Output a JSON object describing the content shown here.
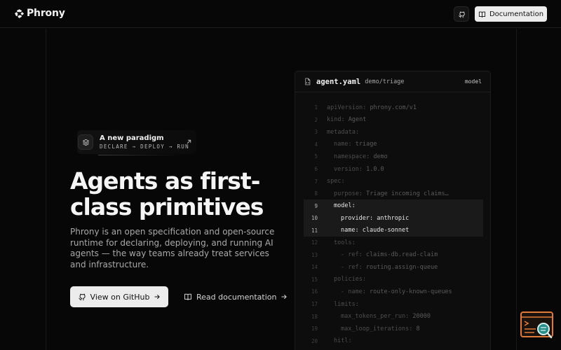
{
  "brand": {
    "name": "Phrony"
  },
  "header": {
    "documentation_label": "Documentation"
  },
  "hero": {
    "badge_title": "A new paradigm",
    "badge_subtitle": "DECLARE → DEPLOY → RUN",
    "headline": "Agents as first-class primitives",
    "lede": "Phrony is an open specification and open-source runtime for declaring, deploying, and running AI agents — the way teams already treat services and infrastructure.",
    "primary_cta": "View on GitHub",
    "secondary_cta": "Read documentation"
  },
  "editor": {
    "file_name": "agent.yaml",
    "file_path": "demo/triage",
    "file_tag": "model",
    "highlighted_lines": [
      9,
      10,
      11
    ],
    "lines": [
      {
        "n": "1",
        "key": "apiVersion",
        "value": "phrony.com/v1",
        "indent": 0
      },
      {
        "n": "2",
        "key": "kind",
        "value": "Agent",
        "indent": 0
      },
      {
        "n": "3",
        "key": "metadata",
        "value": "",
        "indent": 0
      },
      {
        "n": "4",
        "key": "name",
        "value": "triage",
        "indent": 1
      },
      {
        "n": "5",
        "key": "namespace",
        "value": "demo",
        "indent": 1
      },
      {
        "n": "6",
        "key": "version",
        "value": "1.0.0",
        "indent": 1
      },
      {
        "n": "7",
        "key": "spec",
        "value": "",
        "indent": 0
      },
      {
        "n": "8",
        "key": "purpose",
        "value": "Triage incoming claims…",
        "indent": 1
      },
      {
        "n": "9",
        "key": "model",
        "value": "",
        "indent": 1
      },
      {
        "n": "10",
        "key": "provider",
        "value": "anthropic",
        "indent": 2
      },
      {
        "n": "11",
        "key": "name",
        "value": "claude-sonnet",
        "indent": 2
      },
      {
        "n": "12",
        "key": "tools",
        "value": "",
        "indent": 1
      },
      {
        "n": "13",
        "key": "- ref",
        "value": "claims-db.read-claim",
        "indent": 2
      },
      {
        "n": "14",
        "key": "- ref",
        "value": "routing.assign-queue",
        "indent": 2
      },
      {
        "n": "15",
        "key": "policies",
        "value": "",
        "indent": 1
      },
      {
        "n": "16",
        "key": "- name",
        "value": "route-only-known-queues",
        "indent": 2
      },
      {
        "n": "17",
        "key": "limits",
        "value": "",
        "indent": 1
      },
      {
        "n": "18",
        "key": "max_tokens_per_run",
        "value": "20000",
        "indent": 2
      },
      {
        "n": "19",
        "key": "max_loop_iterations",
        "value": "8",
        "indent": 2
      },
      {
        "n": "20",
        "key": "hitl",
        "value": "",
        "indent": 1
      }
    ]
  },
  "colors": {
    "background": "#070707",
    "panel": "#0d0d0d",
    "button": "#ececec",
    "widget_accent": "#e07a3a",
    "widget_teal": "#2a8f8a"
  },
  "icons": [
    "phrony-logo-icon",
    "github-icon",
    "book-icon",
    "layers-icon",
    "arrow-up-right-icon",
    "arrow-right-icon",
    "file-code-icon",
    "terminal-search-icon"
  ]
}
